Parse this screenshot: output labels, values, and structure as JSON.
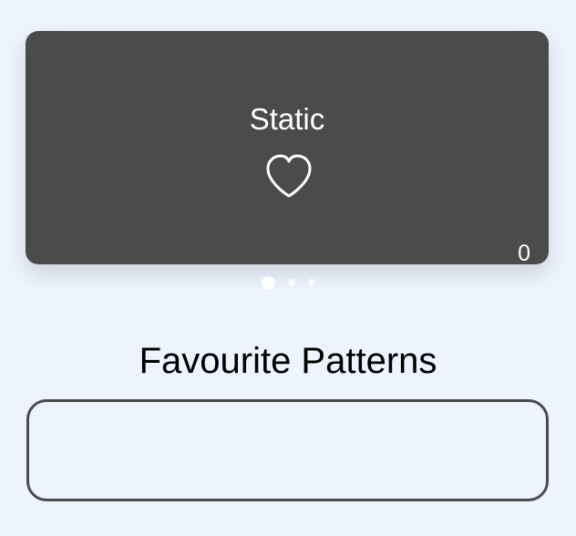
{
  "card": {
    "title": "Static",
    "count": "0",
    "background": "#4a4b4c"
  },
  "carousel": {
    "page_count": 3,
    "active_index": 0
  },
  "favourites": {
    "title": "Favourite Patterns",
    "items": []
  },
  "colors": {
    "page_background": "#edf4fd",
    "border": "#4a4b4c"
  },
  "icons": {
    "like": "heart-outline-icon"
  }
}
